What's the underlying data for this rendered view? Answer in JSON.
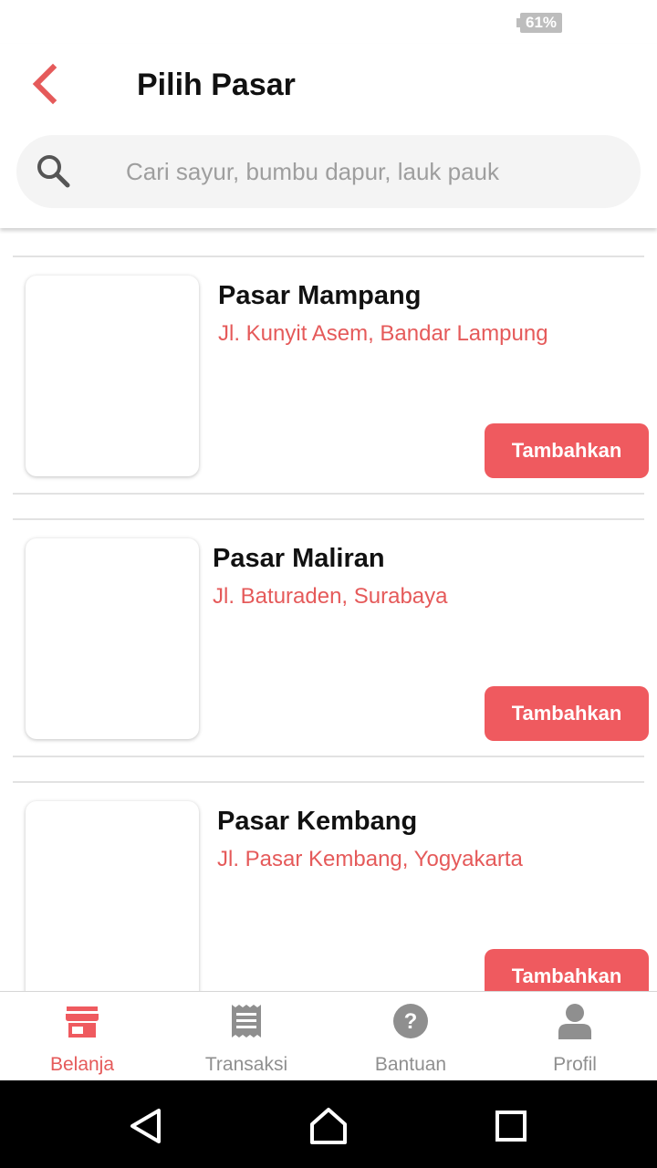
{
  "status_bar": {
    "battery": "61%"
  },
  "header": {
    "title": "Pilih Pasar"
  },
  "search": {
    "placeholder": "Cari sayur, bumbu dapur, lauk pauk",
    "value": ""
  },
  "markets": [
    {
      "name": "Pasar Mampang",
      "address": "Jl. Kunyit Asem, Bandar Lampung",
      "button": "Tambahkan"
    },
    {
      "name": "Pasar Maliran",
      "address": "Jl. Baturaden, Surabaya",
      "button": "Tambahkan"
    },
    {
      "name": "Pasar Kembang",
      "address": "Jl. Pasar Kembang, Yogyakarta",
      "button": "Tambahkan"
    }
  ],
  "bottom_nav": {
    "items": [
      {
        "label": "Belanja",
        "icon": "store-icon",
        "active": true
      },
      {
        "label": "Transaksi",
        "icon": "receipt-icon",
        "active": false
      },
      {
        "label": "Bantuan",
        "icon": "help-icon",
        "active": false
      },
      {
        "label": "Profil",
        "icon": "person-icon",
        "active": false
      }
    ]
  },
  "colors": {
    "accent": "#ef5a5f",
    "address_text": "#e55a5a",
    "nav_inactive": "#8f8f8f"
  }
}
